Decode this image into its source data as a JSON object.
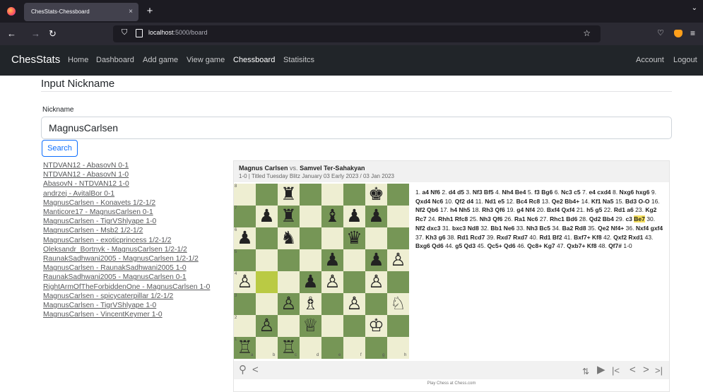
{
  "browser": {
    "tab_title": "ChesStats-Chessboard",
    "tab_close": "×",
    "new_tab": "+",
    "tab_menu": "⌄",
    "back": "←",
    "forward": "→",
    "reload": "↻",
    "url_host": "localhost",
    "url_path": ":5000/board",
    "bookmark": "☆",
    "pocket": "♡",
    "menu": "≡"
  },
  "navbar": {
    "brand": "ChesStats",
    "links": [
      "Home",
      "Dashboard",
      "Add game",
      "View game",
      "Chessboard",
      "Statisitcs"
    ],
    "account": "Account",
    "logout": "Logout"
  },
  "page": {
    "heading": "Input Nickname",
    "nickname_label": "Nickname",
    "nickname_value": "MagnusCarlsen",
    "search_button": "Search"
  },
  "games": [
    "NTDVAN12 - AbasovN 0-1",
    "NTDVAN12 - AbasovN 1-0",
    "AbasovN - NTDVAN12 1-0",
    "andrzej - AvitalBor 0-1",
    "MagnusCarlsen - Konavets 1/2-1/2",
    "Manticore17 - MagnusCarlsen 0-1",
    "MagnusCarlsen - TigrVShlyape 1-0",
    "MagnusCarlsen - Msb2 1/2-1/2",
    "MagnusCarlsen - exoticprincess 1/2-1/2",
    "Oleksandr_Bortnyk - MagnusCarlsen 1/2-1/2",
    "RaunakSadhwani2005 - MagnusCarlsen 1/2-1/2",
    "MagnusCarlsen - RaunakSadhwani2005 1-0",
    "RaunakSadhwani2005 - MagnusCarlsen 0-1",
    "RightArmOfTheForbiddenOne - MagnusCarlsen 1-0",
    "MagnusCarlsen - spicycaterpillar 1/2-1/2",
    "MagnusCarlsen - TigrVShlyape 1-0",
    "MagnusCarlsen - VincentKeymer 1-0"
  ],
  "widget": {
    "white": "Magnus Carlsen",
    "vs": "vs.",
    "black": "Samvel Ter-Sahakyan",
    "event": "1-0 | Titled Tuesday Blitz January 03 Early 2023 / 03 Jan 2023",
    "credit": "Play Chess at Chess.com",
    "current_move": "Be7",
    "moves_before": [
      [
        "1.",
        "a4 Nf6"
      ],
      [
        "2.",
        "d4 d5"
      ],
      [
        "3.",
        "Nf3 Bf5"
      ],
      [
        "4.",
        "Nh4 Be4"
      ],
      [
        "5.",
        "f3 Bg6"
      ],
      [
        "6.",
        "Nc3 c5"
      ],
      [
        "7.",
        "e4 cxd4"
      ],
      [
        "8.",
        "Nxg6 hxg6"
      ],
      [
        "9.",
        "Qxd4 Nc6"
      ],
      [
        "10.",
        "Qf2 d4"
      ],
      [
        "11.",
        "Nd1 e5"
      ],
      [
        "12.",
        "Bc4 Rc8"
      ],
      [
        "13.",
        "Qe2 Bb4+"
      ],
      [
        "14.",
        "Kf1 Na5"
      ],
      [
        "15.",
        "Bd3 O-O"
      ],
      [
        "16.",
        "Nf2 Qb6"
      ],
      [
        "17.",
        "h4 Nh5"
      ],
      [
        "18.",
        "Rh3 Qf6"
      ],
      [
        "19.",
        "g4 Nf4"
      ],
      [
        "20.",
        "Bxf4 Qxf4"
      ],
      [
        "21.",
        "h5 g5"
      ],
      [
        "22.",
        "Rd1 a6"
      ],
      [
        "23.",
        "Kg2 Rc7"
      ],
      [
        "24.",
        "Rhh1 Rfc8"
      ],
      [
        "25.",
        "Nh3 Qf6"
      ],
      [
        "26.",
        "Ra1 Nc6"
      ],
      [
        "27.",
        "Rhc1 Bd6"
      ],
      [
        "28.",
        "Qd2 Bb4"
      ],
      [
        "29.",
        "c3"
      ]
    ],
    "moves_after": [
      [
        "30.",
        "Nf2 dxc3"
      ],
      [
        "31.",
        "bxc3 Nd8"
      ],
      [
        "32.",
        "Bb1 Ne6"
      ],
      [
        "33.",
        "Nh3 Bc5"
      ],
      [
        "34.",
        "Ba2 Rd8"
      ],
      [
        "35.",
        "Qe2 Nf4+"
      ],
      [
        "36.",
        "Nxf4 gxf4"
      ],
      [
        "37.",
        "Kh3 g6"
      ],
      [
        "38.",
        "Rd1 Rcd7"
      ],
      [
        "39.",
        "Rxd7 Rxd7"
      ],
      [
        "40.",
        "Rd1 Bf2"
      ],
      [
        "41.",
        "Bxf7+ Kf8"
      ],
      [
        "42.",
        "Qxf2 Rxd1"
      ],
      [
        "43.",
        "Bxg6 Qd6"
      ],
      [
        "44.",
        "g5 Qd3"
      ],
      [
        "45.",
        "Qc5+ Qd6"
      ],
      [
        "46.",
        "Qc8+ Kg7"
      ],
      [
        "47.",
        "Qxb7+ Kf8"
      ],
      [
        "48.",
        "Qf7#"
      ]
    ],
    "result": "1-0",
    "ranks": [
      "8",
      "7",
      "6",
      "5",
      "4",
      "3",
      "2",
      "1"
    ],
    "files": [
      "a",
      "b",
      "c",
      "d",
      "e",
      "f",
      "g",
      "h"
    ],
    "board": [
      [
        "",
        "",
        "♜",
        "",
        "",
        "",
        "♚",
        ""
      ],
      [
        "",
        "♟",
        "♜",
        "",
        "♝",
        "♟",
        "♟",
        ""
      ],
      [
        "♟",
        "",
        "♞",
        "",
        "",
        "♛",
        "",
        ""
      ],
      [
        "",
        "",
        "",
        "",
        "♟",
        "",
        "♟",
        "♙"
      ],
      [
        "♙",
        "",
        "",
        "♟",
        "♙",
        "",
        "♙",
        ""
      ],
      [
        "",
        "",
        "♙",
        "♗",
        "",
        "♙",
        "",
        "♘"
      ],
      [
        "",
        "♙",
        "",
        "♕",
        "",
        "",
        "♔",
        ""
      ],
      [
        "♖",
        "",
        "♖",
        "",
        "",
        "",
        "",
        ""
      ]
    ],
    "highlight": [
      [
        4,
        1
      ]
    ],
    "foot_left": [
      "⚲",
      "<"
    ],
    "foot_right": [
      "⇅",
      "▶",
      "|<",
      "<",
      ">",
      ">|"
    ]
  }
}
